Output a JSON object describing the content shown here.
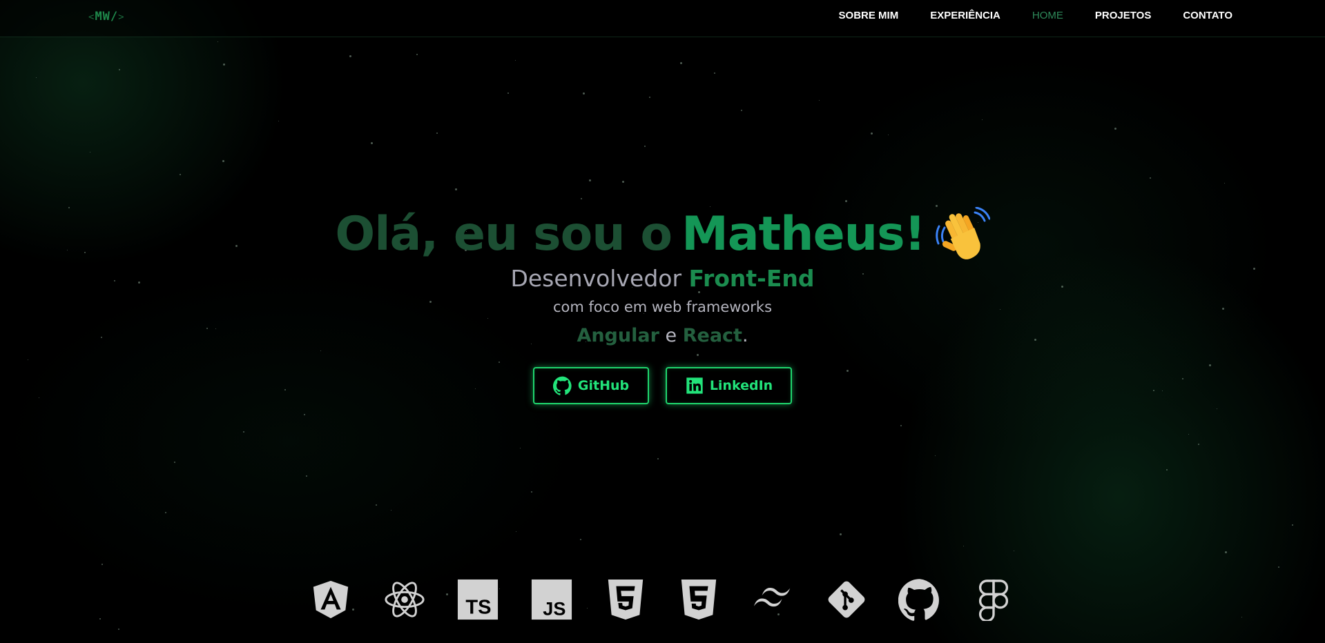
{
  "header": {
    "logo": {
      "open": "<",
      "text": "MW/",
      "close": ">"
    },
    "nav": [
      {
        "label": "SOBRE MIM",
        "active": false
      },
      {
        "label": "EXPERIÊNCIA",
        "active": false
      },
      {
        "label": "HOME",
        "active": true
      },
      {
        "label": "PROJETOS",
        "active": false
      },
      {
        "label": "CONTATO",
        "active": false
      }
    ]
  },
  "hero": {
    "title_part1": "Olá, eu sou o",
    "title_part2": "Matheus!",
    "title_emoji": "waving-hand-icon",
    "subtitle_prefix": "Desenvolvedor",
    "subtitle_accent": "Front-End",
    "focus": "com foco em web frameworks",
    "framework1": "Angular",
    "connector": "e",
    "framework2": "React",
    "period": "."
  },
  "buttons": {
    "github": {
      "label": "GitHub",
      "icon": "github-icon"
    },
    "linkedin": {
      "label": "LinkedIn",
      "icon": "linkedin-icon"
    }
  },
  "tech_icons": [
    "angular-icon",
    "react-icon",
    "typescript-icon",
    "javascript-icon",
    "html5-icon",
    "css3-icon",
    "tailwind-icon",
    "git-icon",
    "github-icon",
    "figma-icon"
  ],
  "colors": {
    "accent": "#1fd66e",
    "title_dark": "#1c4f33",
    "title_green": "#149656",
    "icon": "#d2d2d2"
  }
}
